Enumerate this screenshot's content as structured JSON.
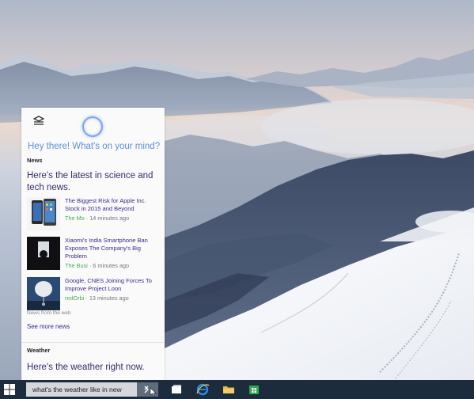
{
  "cortana": {
    "greeting": "Hey there! What's on your mind?",
    "news_label": "News",
    "news_headline": "Here's the latest in science and tech news.",
    "news": [
      {
        "title": "The Biggest Risk for Apple Inc. Stock in 2015 and Beyond",
        "source": "The Mo",
        "time": " · 14 minutes ago",
        "thumb": "phones-icon"
      },
      {
        "title": "Xiaomi's India Smartphone Ban Exposes The Company's Big Problem",
        "source": "The Busi",
        "time": " · 6 minutes ago",
        "thumb": "person-silhouette-icon"
      },
      {
        "title": "Google, CNES Joining Forces To Improve Project Loon",
        "source": "redOrbi",
        "time": " · 13 minutes ago",
        "thumb": "balloon-icon"
      }
    ],
    "from_web": "News from the web",
    "see_more": "See more news",
    "weather_label": "Weather",
    "weather_headline": "Here's the weather right now."
  },
  "taskbar": {
    "search_value": "what's the weather like in new",
    "icons": [
      "start-icon",
      "task-view-icon",
      "internet-explorer-icon",
      "file-explorer-icon",
      "store-icon"
    ]
  },
  "colors": {
    "accent": "#5b8fd6",
    "headline": "#3a2a6e",
    "link": "#3a2a8e",
    "source": "#4caf50",
    "taskbar": "#1c2c3c"
  }
}
